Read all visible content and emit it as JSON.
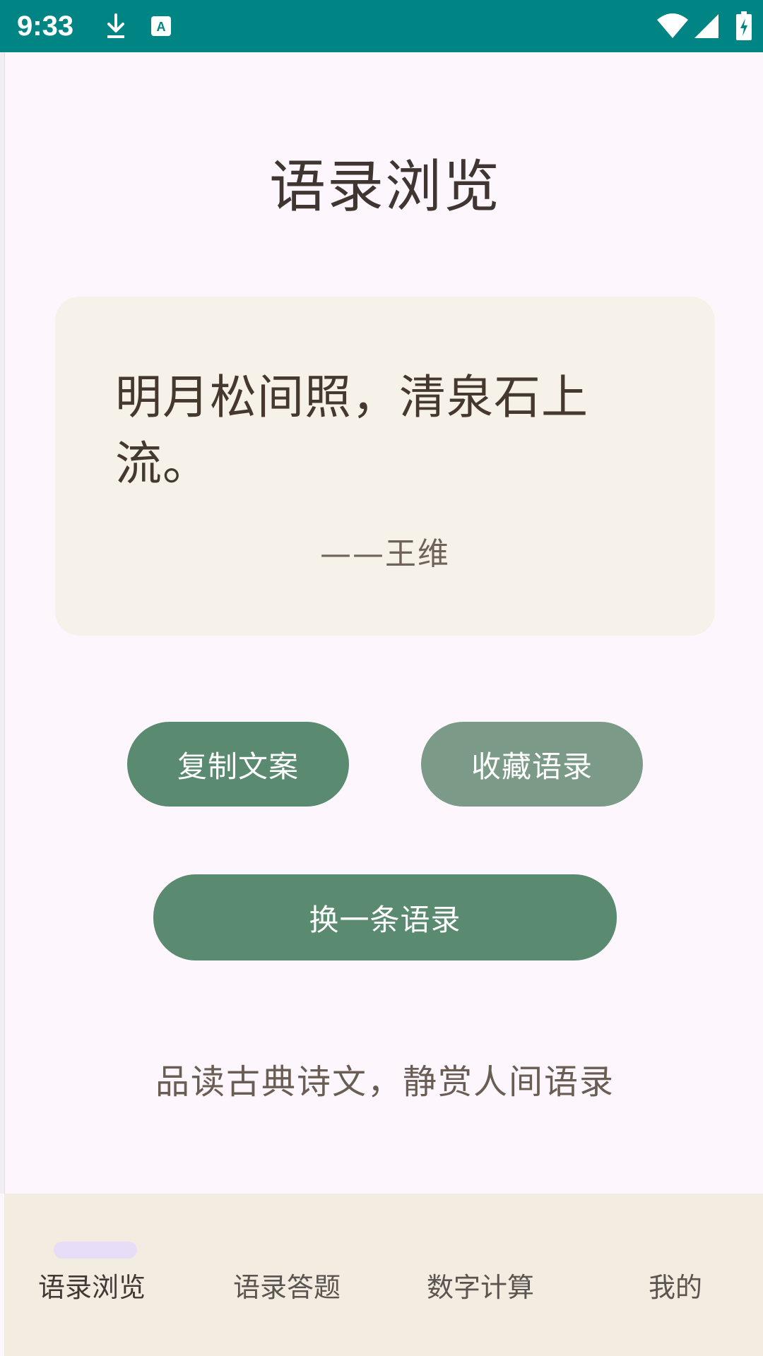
{
  "status_bar": {
    "time": "9:33",
    "icons": [
      "download-icon",
      "a-notification-icon",
      "wifi-icon",
      "signal-icon",
      "battery-charging-icon"
    ]
  },
  "page": {
    "title": "语录浏览"
  },
  "quote": {
    "text": "明月松间照，清泉石上流。",
    "author": "——王维"
  },
  "buttons": {
    "copy": "复制文案",
    "favorite": "收藏语录",
    "next": "换一条语录"
  },
  "slogan": "品读古典诗文，静赏人间语录",
  "bottom_nav": {
    "items": [
      {
        "label": "语录浏览",
        "active": true
      },
      {
        "label": "语录答题",
        "active": false
      },
      {
        "label": "数字计算",
        "active": false
      },
      {
        "label": "我的",
        "active": false
      }
    ]
  },
  "colors": {
    "status_bar": "#008484",
    "primary_button": "#5a8a70",
    "secondary_button": "#7c9a88",
    "card_background": "#f7f2e9",
    "nav_background": "#f3ede1",
    "nav_indicator": "#e7ddf8"
  }
}
